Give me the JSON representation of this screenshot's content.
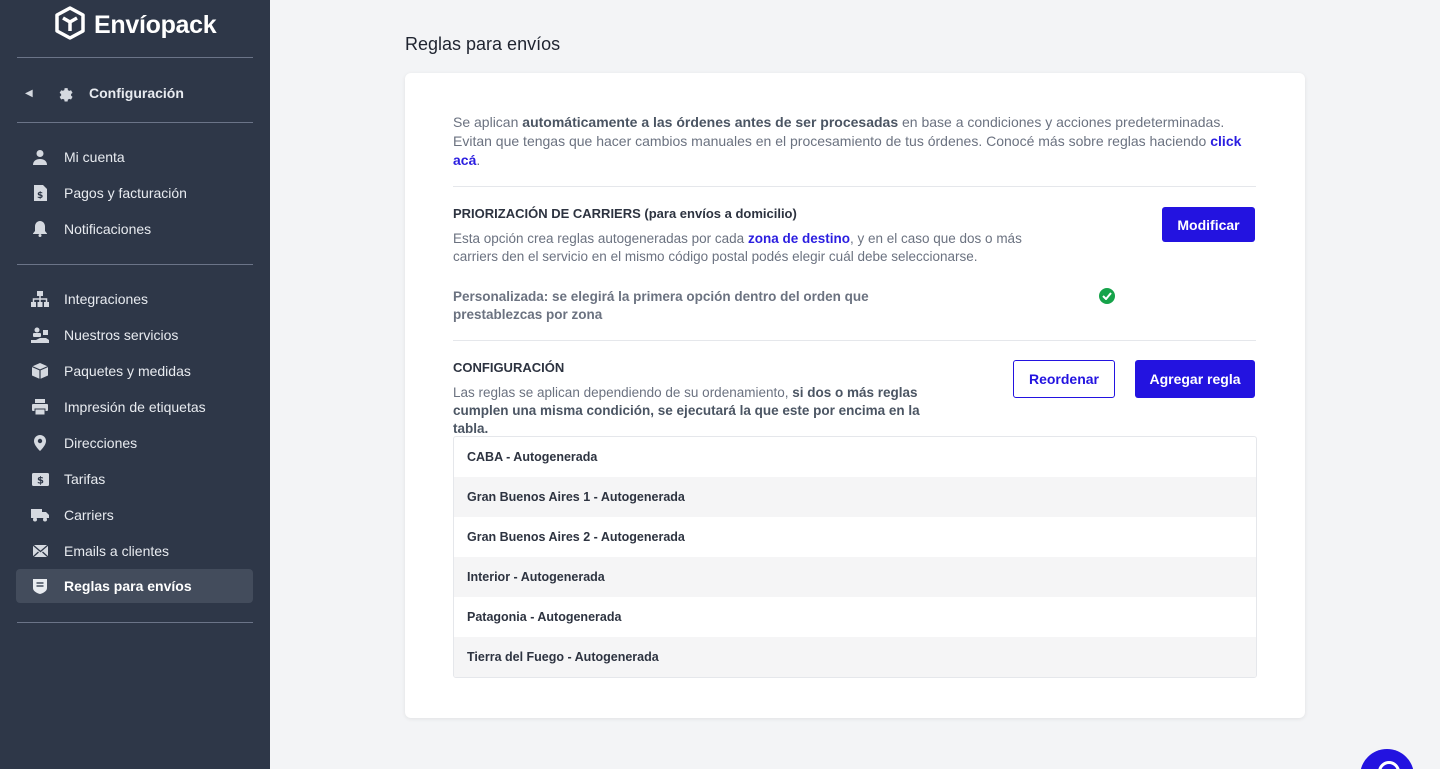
{
  "brand": {
    "name": "Envíopack"
  },
  "sidebar": {
    "section_label": "Configuración",
    "group1": [
      {
        "label": "Mi cuenta",
        "icon": "user-icon"
      },
      {
        "label": "Pagos y facturación",
        "icon": "invoice-icon"
      },
      {
        "label": "Notificaciones",
        "icon": "bell-icon"
      }
    ],
    "group2": [
      {
        "label": "Integraciones",
        "icon": "sitemap-icon"
      },
      {
        "label": "Nuestros servicios",
        "icon": "services-icon"
      },
      {
        "label": "Paquetes y medidas",
        "icon": "box-icon"
      },
      {
        "label": "Impresión de etiquetas",
        "icon": "printer-icon"
      },
      {
        "label": "Direcciones",
        "icon": "map-pin-icon"
      },
      {
        "label": "Tarifas",
        "icon": "money-icon"
      },
      {
        "label": "Carriers",
        "icon": "truck-icon"
      },
      {
        "label": "Emails a clientes",
        "icon": "mail-icon"
      },
      {
        "label": "Reglas para envíos",
        "icon": "rules-icon",
        "active": true
      }
    ]
  },
  "main": {
    "title": "Reglas para envíos",
    "intro": {
      "p1": "Se aplican ",
      "bold": "automáticamente a las órdenes antes de ser procesadas",
      "p2": " en base a condiciones y acciones predeterminadas. Evitan que tengas que hacer cambios manuales en el procesamiento de tus órdenes. Conocé más sobre reglas haciendo ",
      "link": "click acá",
      "p3": "."
    },
    "priority": {
      "title": "PRIORIZACIÓN DE CARRIERS (para envíos a domicilio)",
      "desc1": "Esta opción crea reglas autogeneradas por cada ",
      "link": "zona de destino",
      "desc2": ", y en el caso que dos o más carriers den el servicio en el mismo código postal podés elegir cuál debe seleccionarse.",
      "button": "Modificar",
      "custom": "Personalizada: se elegirá la primera opción dentro del orden que prestablezcas por zona"
    },
    "config": {
      "title": "CONFIGURACIÓN",
      "desc1": "Las reglas se aplican dependiendo de su ordenamiento, ",
      "bold": "si dos o más reglas cumplen una misma condición, se ejecutará la que este por encima en la tabla.",
      "reorder_button": "Reordenar",
      "add_button": "Agregar regla"
    },
    "rules": [
      "CABA - Autogenerada",
      "Gran Buenos Aires 1 - Autogenerada",
      "Gran Buenos Aires 2 - Autogenerada",
      "Interior - Autogenerada",
      "Patagonia - Autogenerada",
      "Tierra del Fuego - Autogenerada"
    ]
  },
  "colors": {
    "sidebar_bg": "#2e3748",
    "accent": "#2313e0",
    "success": "#16a34a"
  }
}
